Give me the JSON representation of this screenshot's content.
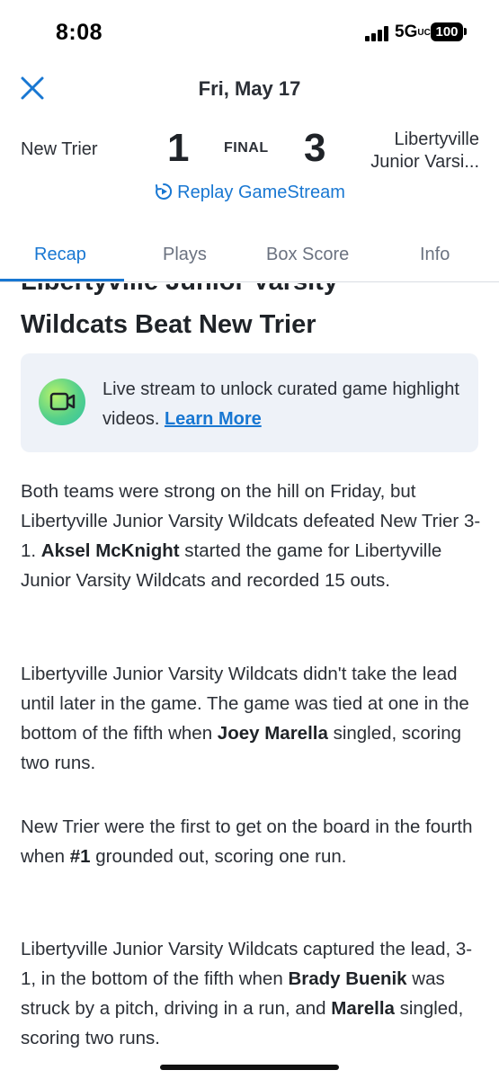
{
  "status_bar": {
    "time": "8:08",
    "network": "5G",
    "network_suffix": "UC",
    "battery": "100"
  },
  "header": {
    "date": "Fri, May 17",
    "home_team": "New Trier",
    "home_score": "1",
    "status": "FINAL",
    "away_score": "3",
    "away_team_line1": "Libertyville",
    "away_team_line2": "Junior Varsi...",
    "replay_label": "Replay GameStream"
  },
  "tabs": [
    {
      "label": "Recap",
      "active": true
    },
    {
      "label": "Plays",
      "active": false
    },
    {
      "label": "Box Score",
      "active": false
    },
    {
      "label": "Info",
      "active": false
    }
  ],
  "recap": {
    "headline_line1": "Libertyville Junior Varsity",
    "headline_line2": "Wildcats Beat New Trier",
    "promo_text": "Live stream to unlock curated game highlight videos.",
    "promo_link": "Learn More",
    "p1_a": "Both teams were strong on the hill on Friday, but Libertyville Junior Varsity Wildcats defeated New Trier 3-1. ",
    "p1_b": "Aksel McKnight",
    "p1_c": " started the game for Libertyville Junior Varsity Wildcats and recorded 15 outs.",
    "p2_a": "Libertyville Junior Varsity Wildcats didn't take the lead until later in the game. The game was tied at one in the bottom of the fifth when ",
    "p2_b": "Joey Marella",
    "p2_c": " singled, scoring two runs.",
    "p3_a": "New Trier were the first to get on the board in the fourth when ",
    "p3_b": "#1",
    "p3_c": " grounded out, scoring one run.",
    "p4_a": "Libertyville Junior Varsity Wildcats captured the lead, 3-1, in the bottom of the fifth when ",
    "p4_b": "Brady Buenik",
    "p4_c": " was struck by a pitch, driving in a run, and ",
    "p4_d": "Marella",
    "p4_e": " singled, scoring two runs."
  },
  "colors": {
    "accent": "#1877d2",
    "promo_bg": "#eef2f8",
    "text": "#2b2f36"
  }
}
